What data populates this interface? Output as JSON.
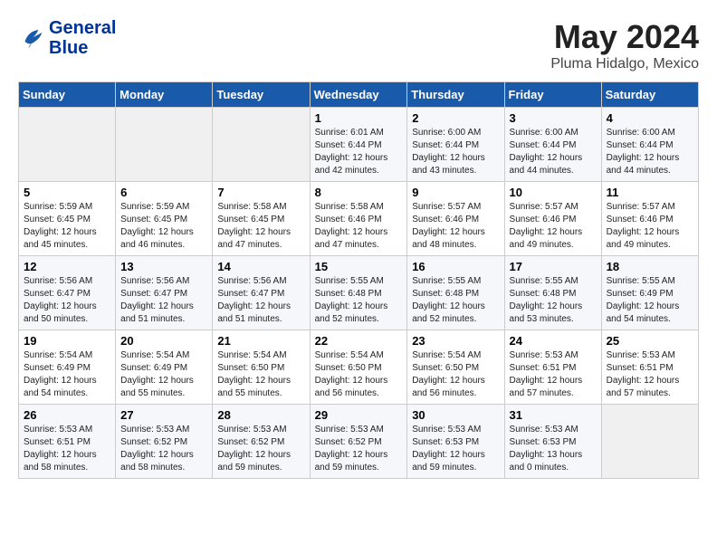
{
  "header": {
    "logo_line1": "General",
    "logo_line2": "Blue",
    "month": "May 2024",
    "location": "Pluma Hidalgo, Mexico"
  },
  "weekdays": [
    "Sunday",
    "Monday",
    "Tuesday",
    "Wednesday",
    "Thursday",
    "Friday",
    "Saturday"
  ],
  "weeks": [
    [
      {
        "num": "",
        "info": ""
      },
      {
        "num": "",
        "info": ""
      },
      {
        "num": "",
        "info": ""
      },
      {
        "num": "1",
        "info": "Sunrise: 6:01 AM\nSunset: 6:44 PM\nDaylight: 12 hours\nand 42 minutes."
      },
      {
        "num": "2",
        "info": "Sunrise: 6:00 AM\nSunset: 6:44 PM\nDaylight: 12 hours\nand 43 minutes."
      },
      {
        "num": "3",
        "info": "Sunrise: 6:00 AM\nSunset: 6:44 PM\nDaylight: 12 hours\nand 44 minutes."
      },
      {
        "num": "4",
        "info": "Sunrise: 6:00 AM\nSunset: 6:44 PM\nDaylight: 12 hours\nand 44 minutes."
      }
    ],
    [
      {
        "num": "5",
        "info": "Sunrise: 5:59 AM\nSunset: 6:45 PM\nDaylight: 12 hours\nand 45 minutes."
      },
      {
        "num": "6",
        "info": "Sunrise: 5:59 AM\nSunset: 6:45 PM\nDaylight: 12 hours\nand 46 minutes."
      },
      {
        "num": "7",
        "info": "Sunrise: 5:58 AM\nSunset: 6:45 PM\nDaylight: 12 hours\nand 47 minutes."
      },
      {
        "num": "8",
        "info": "Sunrise: 5:58 AM\nSunset: 6:46 PM\nDaylight: 12 hours\nand 47 minutes."
      },
      {
        "num": "9",
        "info": "Sunrise: 5:57 AM\nSunset: 6:46 PM\nDaylight: 12 hours\nand 48 minutes."
      },
      {
        "num": "10",
        "info": "Sunrise: 5:57 AM\nSunset: 6:46 PM\nDaylight: 12 hours\nand 49 minutes."
      },
      {
        "num": "11",
        "info": "Sunrise: 5:57 AM\nSunset: 6:46 PM\nDaylight: 12 hours\nand 49 minutes."
      }
    ],
    [
      {
        "num": "12",
        "info": "Sunrise: 5:56 AM\nSunset: 6:47 PM\nDaylight: 12 hours\nand 50 minutes."
      },
      {
        "num": "13",
        "info": "Sunrise: 5:56 AM\nSunset: 6:47 PM\nDaylight: 12 hours\nand 51 minutes."
      },
      {
        "num": "14",
        "info": "Sunrise: 5:56 AM\nSunset: 6:47 PM\nDaylight: 12 hours\nand 51 minutes."
      },
      {
        "num": "15",
        "info": "Sunrise: 5:55 AM\nSunset: 6:48 PM\nDaylight: 12 hours\nand 52 minutes."
      },
      {
        "num": "16",
        "info": "Sunrise: 5:55 AM\nSunset: 6:48 PM\nDaylight: 12 hours\nand 52 minutes."
      },
      {
        "num": "17",
        "info": "Sunrise: 5:55 AM\nSunset: 6:48 PM\nDaylight: 12 hours\nand 53 minutes."
      },
      {
        "num": "18",
        "info": "Sunrise: 5:55 AM\nSunset: 6:49 PM\nDaylight: 12 hours\nand 54 minutes."
      }
    ],
    [
      {
        "num": "19",
        "info": "Sunrise: 5:54 AM\nSunset: 6:49 PM\nDaylight: 12 hours\nand 54 minutes."
      },
      {
        "num": "20",
        "info": "Sunrise: 5:54 AM\nSunset: 6:49 PM\nDaylight: 12 hours\nand 55 minutes."
      },
      {
        "num": "21",
        "info": "Sunrise: 5:54 AM\nSunset: 6:50 PM\nDaylight: 12 hours\nand 55 minutes."
      },
      {
        "num": "22",
        "info": "Sunrise: 5:54 AM\nSunset: 6:50 PM\nDaylight: 12 hours\nand 56 minutes."
      },
      {
        "num": "23",
        "info": "Sunrise: 5:54 AM\nSunset: 6:50 PM\nDaylight: 12 hours\nand 56 minutes."
      },
      {
        "num": "24",
        "info": "Sunrise: 5:53 AM\nSunset: 6:51 PM\nDaylight: 12 hours\nand 57 minutes."
      },
      {
        "num": "25",
        "info": "Sunrise: 5:53 AM\nSunset: 6:51 PM\nDaylight: 12 hours\nand 57 minutes."
      }
    ],
    [
      {
        "num": "26",
        "info": "Sunrise: 5:53 AM\nSunset: 6:51 PM\nDaylight: 12 hours\nand 58 minutes."
      },
      {
        "num": "27",
        "info": "Sunrise: 5:53 AM\nSunset: 6:52 PM\nDaylight: 12 hours\nand 58 minutes."
      },
      {
        "num": "28",
        "info": "Sunrise: 5:53 AM\nSunset: 6:52 PM\nDaylight: 12 hours\nand 59 minutes."
      },
      {
        "num": "29",
        "info": "Sunrise: 5:53 AM\nSunset: 6:52 PM\nDaylight: 12 hours\nand 59 minutes."
      },
      {
        "num": "30",
        "info": "Sunrise: 5:53 AM\nSunset: 6:53 PM\nDaylight: 12 hours\nand 59 minutes."
      },
      {
        "num": "31",
        "info": "Sunrise: 5:53 AM\nSunset: 6:53 PM\nDaylight: 13 hours\nand 0 minutes."
      },
      {
        "num": "",
        "info": ""
      }
    ]
  ]
}
